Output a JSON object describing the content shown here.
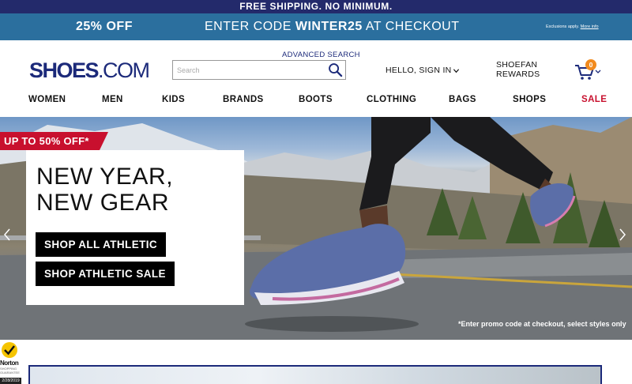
{
  "top_banner": {
    "text": "FREE SHIPPING. NO MINIMUM."
  },
  "promo_banner": {
    "discount": "25% OFF",
    "code_prefix": "ENTER CODE ",
    "code": "WINTER25",
    "code_suffix": " AT CHECKOUT",
    "exclusions": "Exclusions apply.",
    "more_info": "More info"
  },
  "header": {
    "logo_main": "SHOES",
    "logo_suffix": ".COM",
    "advanced_search": "ADVANCED SEARCH",
    "search_placeholder": "Search",
    "sign_in": "HELLO, SIGN IN",
    "rewards_line1": "SHOEFAN",
    "rewards_line2": "REWARDS",
    "cart_count": "0"
  },
  "nav": {
    "items": [
      {
        "label": "WOMEN"
      },
      {
        "label": "MEN"
      },
      {
        "label": "KIDS"
      },
      {
        "label": "BRANDS"
      },
      {
        "label": "BOOTS"
      },
      {
        "label": "CLOTHING"
      },
      {
        "label": "BAGS"
      },
      {
        "label": "SHOPS"
      },
      {
        "label": "SALE"
      }
    ]
  },
  "hero": {
    "badge": "UP TO 50% OFF*",
    "title_line1": "NEW YEAR,",
    "title_line2": "NEW GEAR",
    "button_1": "SHOP ALL ATHLETIC",
    "button_2": "SHOP ATHLETIC SALE",
    "fine_print": "*Enter promo code at checkout, select styles only"
  },
  "norton": {
    "brand": "Norton",
    "sub": "SHOPPING GUARANTEE",
    "date": "2/28/2019"
  },
  "colors": {
    "top_banner": "#232a6b",
    "promo_banner": "#2b6f9e",
    "brand_blue": "#1c2a7a",
    "sale_red": "#c8102e",
    "cart_badge": "#f28b1e"
  },
  "icons": {
    "search": "search-icon",
    "cart": "cart-icon",
    "chevron": "chevron-down-icon",
    "prev": "chevron-left-icon",
    "next": "chevron-right-icon",
    "norton": "checkmark-icon"
  }
}
